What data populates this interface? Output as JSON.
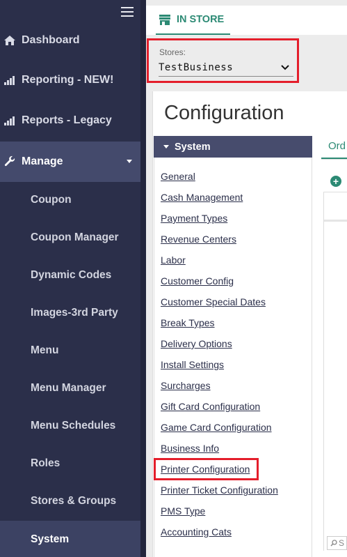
{
  "sidebar": {
    "nav": [
      {
        "label": "Dashboard",
        "icon": "home-icon"
      },
      {
        "label": "Reporting - NEW!",
        "icon": "bar-chart-icon"
      },
      {
        "label": "Reports - Legacy",
        "icon": "bar-chart-icon"
      },
      {
        "label": "Manage",
        "icon": "wrench-icon"
      }
    ],
    "manage_items": [
      {
        "label": "Coupon"
      },
      {
        "label": "Coupon Manager"
      },
      {
        "label": "Dynamic Codes"
      },
      {
        "label": "Images-3rd Party"
      },
      {
        "label": "Menu"
      },
      {
        "label": "Menu Manager"
      },
      {
        "label": "Menu Schedules"
      },
      {
        "label": "Roles"
      },
      {
        "label": "Stores & Groups"
      },
      {
        "label": "System"
      }
    ],
    "active_item": "System"
  },
  "topbar": {
    "tab_label": "IN STORE",
    "tab_icon": "store-icon"
  },
  "stores": {
    "label": "Stores:",
    "selected": "TestBusiness"
  },
  "config": {
    "title": "Configuration",
    "section_label": "System",
    "links": [
      "General",
      "Cash Management",
      "Payment Types",
      "Revenue Centers",
      "Labor",
      "Customer Config",
      "Customer Special Dates",
      "Break Types",
      "Delivery Options",
      "Install Settings",
      "Surcharges",
      "Gift Card Configuration",
      "Game Card Configuration",
      "Business Info",
      "Printer Configuration",
      "Printer Ticket Configuration",
      "PMS Type",
      "Accounting Cats"
    ]
  },
  "right_panel": {
    "tab_label": "Ord",
    "search_text": "S"
  },
  "colors": {
    "sidebar_bg": "#2b2f4a",
    "accent_green": "#2c8a74",
    "highlight_red": "#e41e2b",
    "section_header_bg": "#474c6d"
  }
}
